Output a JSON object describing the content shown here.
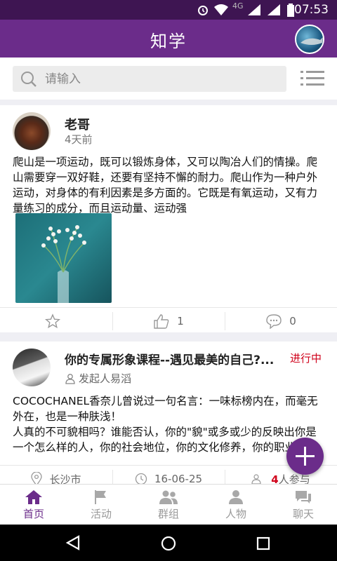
{
  "status_bar": {
    "time": "07:53",
    "network": "4G"
  },
  "app": {
    "title": "知学"
  },
  "search": {
    "placeholder": "请输入"
  },
  "post": {
    "author": "老哥",
    "time": "4天前",
    "text": "爬山是一项运动，既可以锻炼身体，又可以陶冶人们的情操。爬山需要穿一双好鞋，还要有坚持不懈的耐力。爬山作为一种户外运动，对身体的有利因素是多方面的。它既是有氧运动，又有力量练习的成分，而且运动量、运动强",
    "likes": "1",
    "comments": "0"
  },
  "event": {
    "title": "你的专属形象课程--遇见最美的自己?...",
    "status": "进行中",
    "host": "发起人易滔",
    "text": "COCOCHANEL香奈儿曾说过一句名言：一味标榜内在，而毫无外在，也是一种肤浅！\n人真的不可貌相吗？谁能否认，你的\"貌\"或多或少的反映出你是一个怎么样的人，你的社会地位，你的文化修养，你的职业，你",
    "location": "长沙市",
    "date": "16-06-25",
    "participants_count": "4",
    "participants_suffix": "人参与"
  },
  "bottom_nav": [
    {
      "label": "首页",
      "icon": "home-icon",
      "active": true
    },
    {
      "label": "活动",
      "icon": "flag-icon",
      "active": false
    },
    {
      "label": "群组",
      "icon": "group-icon",
      "active": false
    },
    {
      "label": "人物",
      "icon": "person-icon",
      "active": false
    },
    {
      "label": "聊天",
      "icon": "chat-icon",
      "active": false
    }
  ],
  "colors": {
    "primary": "#6b2c8a",
    "status_bar": "#3e1552",
    "accent_red": "#d0021b"
  }
}
